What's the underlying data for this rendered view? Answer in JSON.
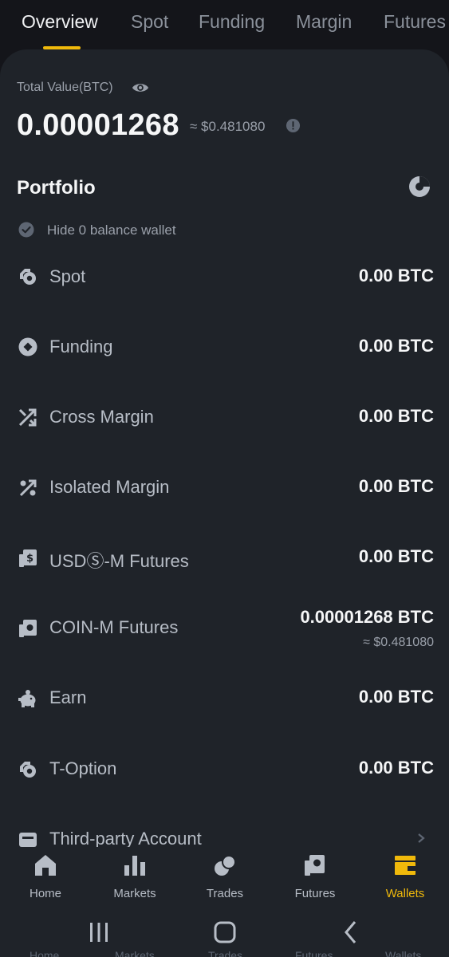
{
  "tabs": [
    "Overview",
    "Spot",
    "Funding",
    "Margin",
    "Futures"
  ],
  "total": {
    "label": "Total Value(BTC)",
    "value": "0.00001268",
    "approx": "≈ $0.481080"
  },
  "portfolio": {
    "title": "Portfolio",
    "hide_label": "Hide 0 balance wallet",
    "hide_checked": true
  },
  "accounts": [
    {
      "name": "Spot",
      "value": "0.00 BTC",
      "icon": "spot-icon"
    },
    {
      "name": "Funding",
      "value": "0.00 BTC",
      "icon": "funding-icon"
    },
    {
      "name": "Cross Margin",
      "value": "0.00 BTC",
      "icon": "cross-margin-icon"
    },
    {
      "name": "Isolated Margin",
      "value": "0.00 BTC",
      "icon": "isolated-margin-icon"
    },
    {
      "name": "USDⓈ-M Futures",
      "value": "0.00 BTC",
      "icon": "usds-futures-icon"
    },
    {
      "name": "COIN-M Futures",
      "value": "0.00001268 BTC",
      "sub": "≈ $0.481080",
      "icon": "coin-futures-icon"
    },
    {
      "name": "Earn",
      "value": "0.00 BTC",
      "icon": "earn-icon"
    },
    {
      "name": "T-Option",
      "value": "0.00 BTC",
      "icon": "t-option-icon"
    },
    {
      "name": "Third-party Account",
      "icon": "third-party-icon"
    }
  ],
  "nav": [
    {
      "label": "Home",
      "icon": "home-icon"
    },
    {
      "label": "Markets",
      "icon": "markets-icon"
    },
    {
      "label": "Trades",
      "icon": "trades-icon"
    },
    {
      "label": "Futures",
      "icon": "futures-icon"
    },
    {
      "label": "Wallets",
      "icon": "wallet-icon",
      "active": true
    }
  ],
  "system_ghost": [
    "Home",
    "Markets",
    "Trades",
    "Futures",
    "Wallets"
  ],
  "colors": {
    "accent": "#f0b90b",
    "panel": "#1f2329",
    "background": "#14151a"
  }
}
